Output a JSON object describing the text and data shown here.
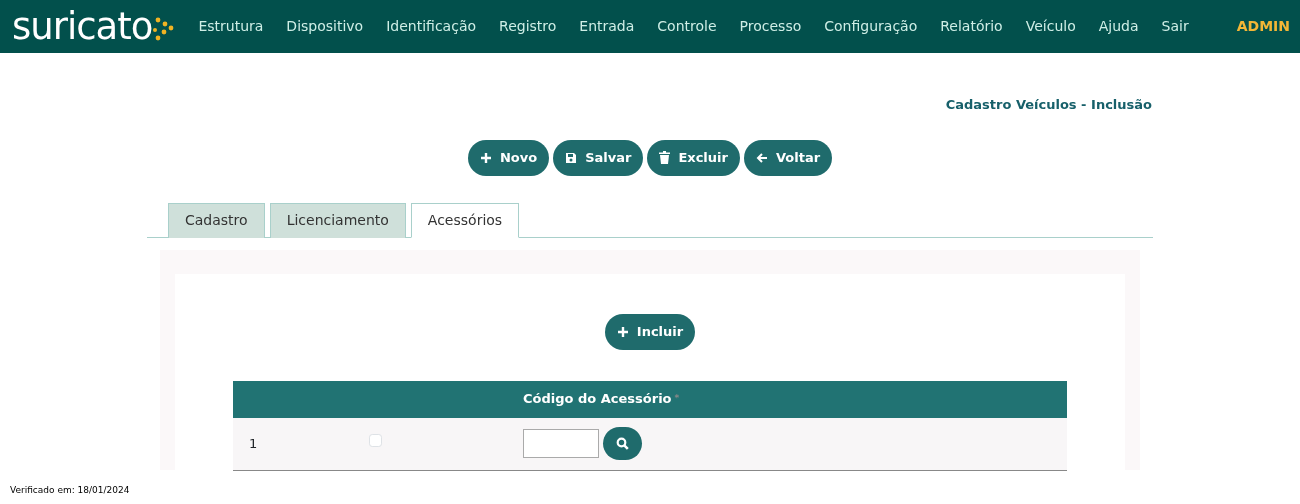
{
  "brand": "suricato",
  "menu": [
    {
      "label": "Estrutura"
    },
    {
      "label": "Dispositivo"
    },
    {
      "label": "Identificação"
    },
    {
      "label": "Registro"
    },
    {
      "label": "Entrada"
    },
    {
      "label": "Controle"
    },
    {
      "label": "Processo"
    },
    {
      "label": "Configuração"
    },
    {
      "label": "Relatório"
    },
    {
      "label": "Veículo"
    },
    {
      "label": "Ajuda"
    },
    {
      "label": "Sair"
    }
  ],
  "user": "ADMIN",
  "page_title": "Cadastro Veículos - Inclusão",
  "actions": [
    {
      "label": "Novo",
      "kind": "plus"
    },
    {
      "label": "Salvar",
      "kind": "save"
    },
    {
      "label": "Excluir",
      "kind": "trash"
    },
    {
      "label": "Voltar",
      "kind": "back"
    }
  ],
  "tabs": [
    {
      "label": "Cadastro",
      "selected": false
    },
    {
      "label": "Licenciamento",
      "selected": false
    },
    {
      "label": "Acessórios",
      "selected": true
    }
  ],
  "include_button": "Incluir",
  "table": {
    "columns": [
      {
        "label": "Código do Acessório",
        "required_mark": "*"
      }
    ],
    "rows": [
      {
        "number": "1",
        "checked": false
      }
    ]
  },
  "footer": "Verificado em: 18/01/2024"
}
